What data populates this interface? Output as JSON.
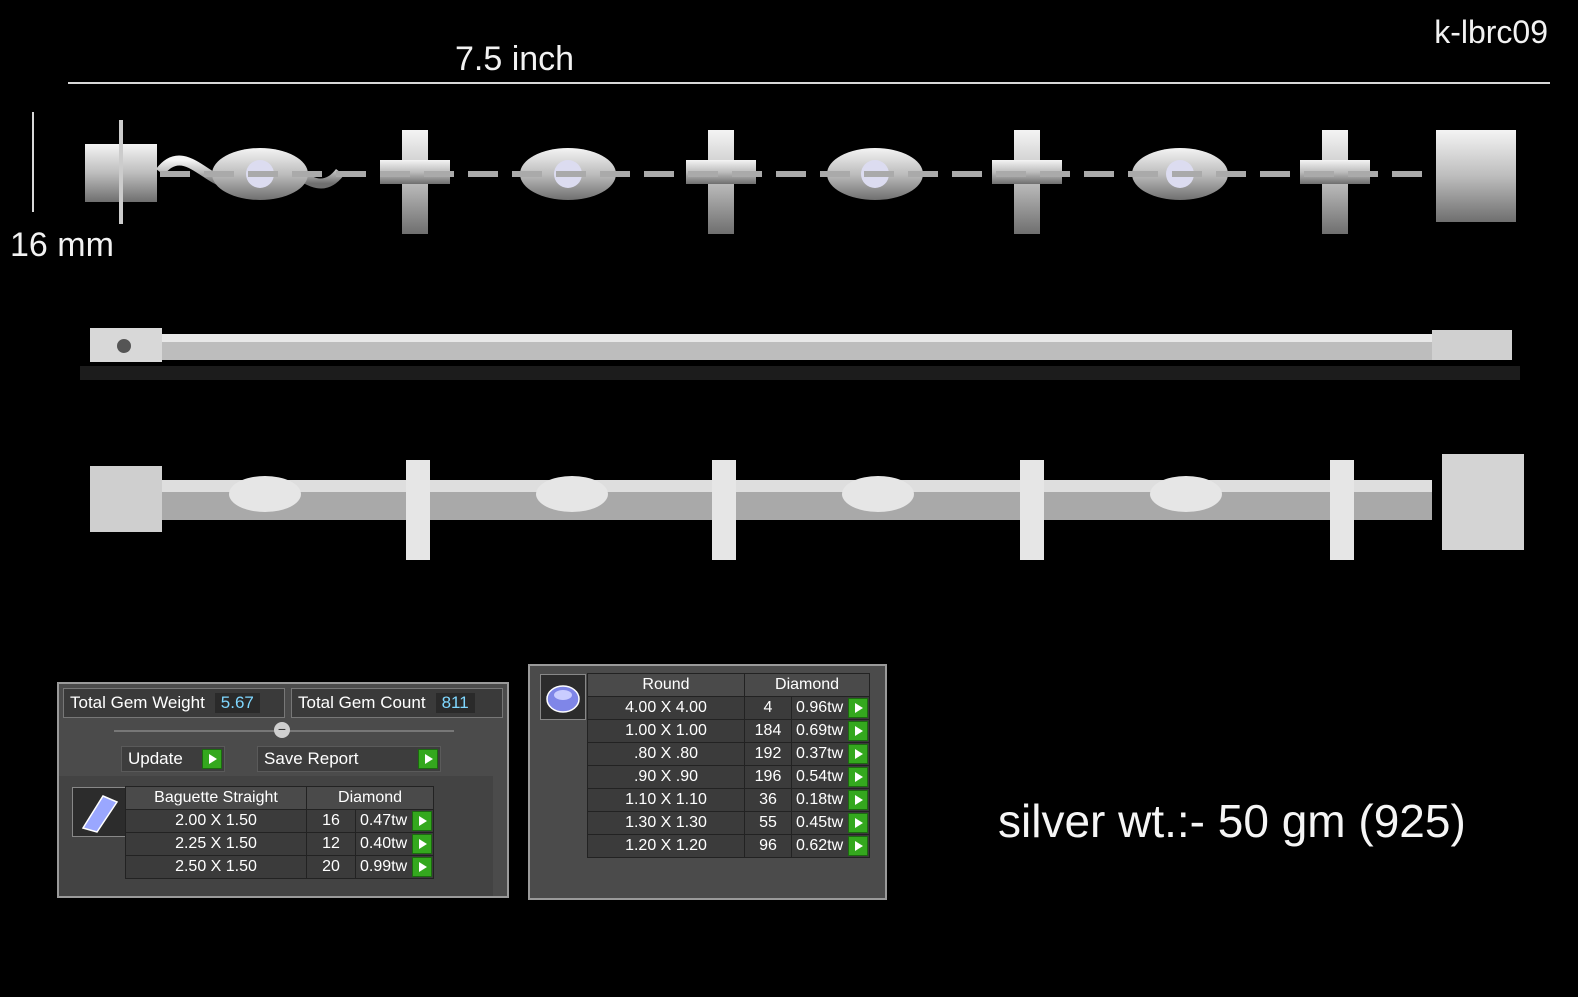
{
  "sku": "k-lbrc09",
  "dimensions": {
    "length": "7.5 inch",
    "height": "16 mm"
  },
  "silver_weight": "silver wt.:- 50 gm (925)",
  "summary_panel": {
    "total_gem_weight_label": "Total Gem Weight",
    "total_gem_weight": "5.67",
    "total_gem_count_label": "Total Gem Count",
    "total_gem_count": "811",
    "update_label": "Update",
    "save_report_label": "Save Report",
    "gem_icon": "baguette-gem-icon",
    "shape": "Baguette Straight",
    "material": "Diamond",
    "rows": [
      {
        "size": "2.00 X 1.50",
        "count": "16",
        "carat": "0.47tw"
      },
      {
        "size": "2.25 X 1.50",
        "count": "12",
        "carat": "0.40tw"
      },
      {
        "size": "2.50 X 1.50",
        "count": "20",
        "carat": "0.99tw"
      }
    ]
  },
  "round_panel": {
    "gem_icon": "round-gem-icon",
    "shape": "Round",
    "material": "Diamond",
    "rows": [
      {
        "size": "4.00 X 4.00",
        "count": "4",
        "carat": "0.96tw"
      },
      {
        "size": "1.00 X 1.00",
        "count": "184",
        "carat": "0.69tw"
      },
      {
        "size": ".80 X .80",
        "count": "192",
        "carat": "0.37tw"
      },
      {
        "size": ".90 X .90",
        "count": "196",
        "carat": "0.54tw"
      },
      {
        "size": "1.10 X 1.10",
        "count": "36",
        "carat": "0.18tw"
      },
      {
        "size": "1.30 X 1.30",
        "count": "55",
        "carat": "0.45tw"
      },
      {
        "size": "1.20 X 1.20",
        "count": "96",
        "carat": "0.62tw"
      }
    ]
  },
  "colors": {
    "accent_button": "#34a81e",
    "value_text": "#7fd7ff",
    "panel_bg": "#4b4b4b"
  }
}
